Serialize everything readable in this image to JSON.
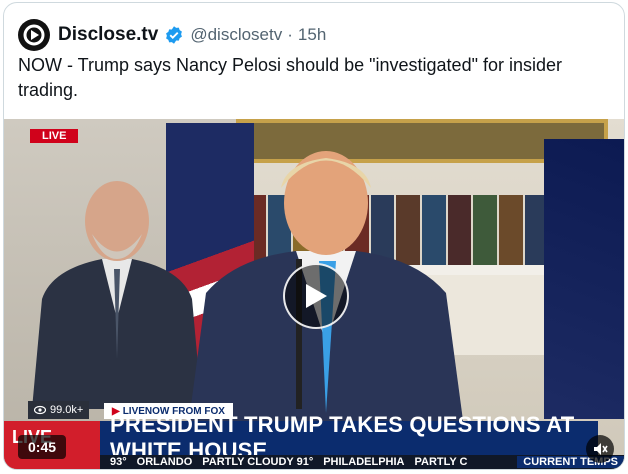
{
  "tweet": {
    "author_name": "Disclose.tv",
    "handle": "@disclosetv",
    "separator": "·",
    "time": "15h",
    "text": "NOW - Trump says Nancy Pelosi should be \"investigated\" for insider trading."
  },
  "video": {
    "live_badge": "LIVE",
    "viewer_count": "99.0k+",
    "source": "LIVENOW FROM FOX",
    "headline": "PRESIDENT TRUMP TAKES QUESTIONS AT WHITE HOUSE",
    "ticker": [
      "93°",
      "ORLANDO",
      "PARTLY CLOUDY 91°",
      "PHILADELPHIA",
      "PARTLY C"
    ],
    "ticker_label": "CURRENT TEMPS",
    "duration": "0:45",
    "icons": [
      "play-icon",
      "volume-icon"
    ],
    "colors": {
      "headline_bg": "#0b2c6e",
      "live_red": "#d0021b",
      "verified_blue": "#1d9bf0"
    }
  }
}
